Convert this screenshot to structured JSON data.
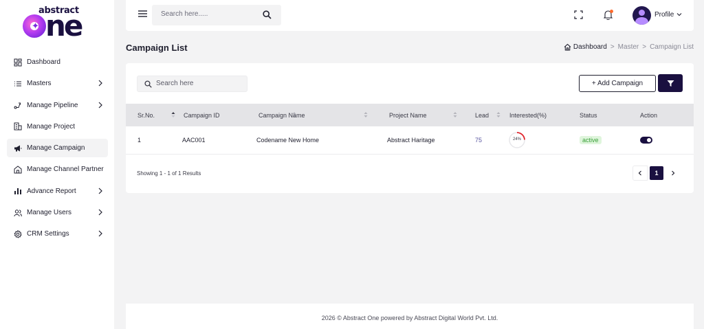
{
  "brand": {
    "logo_small": "abstract",
    "logo_big": "ne"
  },
  "sidebar": {
    "items": [
      {
        "label": "Dashboard",
        "icon": "dashboard-icon",
        "has_children": false,
        "active": false
      },
      {
        "label": "Masters",
        "icon": "list-icon",
        "has_children": true,
        "active": false
      },
      {
        "label": "Manage Pipeline",
        "icon": "pipeline-icon",
        "has_children": true,
        "active": false
      },
      {
        "label": "Manage Project",
        "icon": "building-icon",
        "has_children": false,
        "active": false
      },
      {
        "label": "Manage Campaign",
        "icon": "megaphone-icon",
        "has_children": false,
        "active": true
      },
      {
        "label": "Manage Channel Partner",
        "icon": "partner-icon",
        "has_children": false,
        "active": false
      },
      {
        "label": "Advance Report",
        "icon": "bar-chart-icon",
        "has_children": true,
        "active": false
      },
      {
        "label": "Manage Users",
        "icon": "users-icon",
        "has_children": true,
        "active": false
      },
      {
        "label": "CRM Settings",
        "icon": "gear-icon",
        "has_children": true,
        "active": false
      }
    ]
  },
  "header": {
    "search_placeholder": "Search here.....",
    "profile_label": "Profile"
  },
  "page": {
    "title": "Campaign List",
    "breadcrumb": [
      "Dashboard",
      "Master",
      "Campaign List"
    ]
  },
  "toolbar": {
    "search_placeholder": "Search here",
    "add_label": "+ Add Campaign"
  },
  "table": {
    "columns": [
      "Sr.No.",
      "Campaign ID",
      "Campaign Name",
      "Project Name",
      "Lead",
      "Interested(%)",
      "Status",
      "Action"
    ],
    "rows": [
      {
        "sr": "1",
        "campaign_id": "AAC001",
        "campaign_name": "Codename New Home",
        "project_name": "Abstract Haritage",
        "lead": "75",
        "interested_label": "24%",
        "interested_value": 24,
        "status": "active",
        "enabled": true
      }
    ]
  },
  "pagination": {
    "summary": "Showing 1 - 1 of 1 Results",
    "current": "1"
  },
  "footer": {
    "text": "2026 © Abstract One powered by Abstract Digital World Pvt. Ltd."
  },
  "colors": {
    "primary": "#1a1040",
    "active_badge_bg": "#dff5dc",
    "active_badge_text": "#3aa03a",
    "progress_arc": "#e0242c",
    "notification_dot": "#ff6a2b"
  }
}
